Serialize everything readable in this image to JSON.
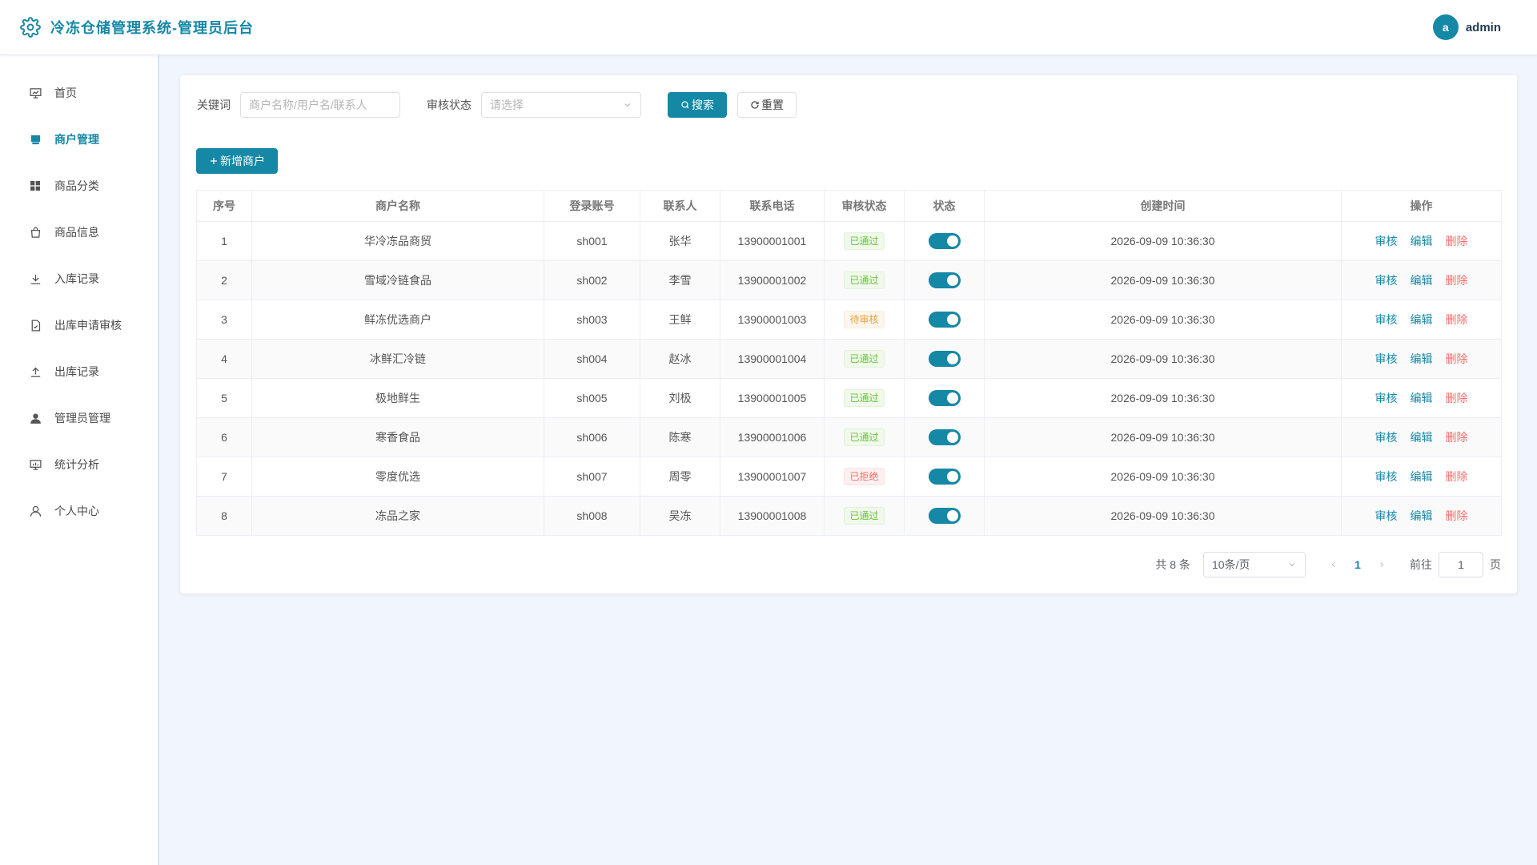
{
  "header": {
    "title": "冷冻仓储管理系统-管理员后台",
    "avatar_letter": "a",
    "username": "admin"
  },
  "sidebar": {
    "items": [
      {
        "label": "首页",
        "icon": "dashboard-icon"
      },
      {
        "label": "商户管理",
        "icon": "store-icon",
        "active": true
      },
      {
        "label": "商品分类",
        "icon": "grid-icon"
      },
      {
        "label": "商品信息",
        "icon": "bag-icon"
      },
      {
        "label": "入库记录",
        "icon": "download-icon"
      },
      {
        "label": "出库申请审核",
        "icon": "doc-check-icon"
      },
      {
        "label": "出库记录",
        "icon": "upload-icon"
      },
      {
        "label": "管理员管理",
        "icon": "user-solid-icon"
      },
      {
        "label": "统计分析",
        "icon": "chart-icon"
      },
      {
        "label": "个人中心",
        "icon": "user-icon"
      }
    ]
  },
  "filters": {
    "keyword_label": "关键词",
    "keyword_placeholder": "商户名称/用户名/联系人",
    "status_label": "审核状态",
    "status_placeholder": "请选择",
    "search_label": "搜索",
    "reset_label": "重置"
  },
  "toolbar": {
    "add_label": "新增商户"
  },
  "table": {
    "columns": [
      "序号",
      "商户名称",
      "登录账号",
      "联系人",
      "联系电话",
      "审核状态",
      "状态",
      "创建时间",
      "操作"
    ],
    "actions": {
      "audit": "审核",
      "edit": "编辑",
      "delete": "删除"
    },
    "rows": [
      {
        "no": "1",
        "name": "华冷冻品商贸",
        "account": "sh001",
        "contact": "张华",
        "phone": "13900001001",
        "audit": "已通过",
        "audit_kind": "ok",
        "enabled": true,
        "created": "2026-09-09 10:36:30"
      },
      {
        "no": "2",
        "name": "雪域冷链食品",
        "account": "sh002",
        "contact": "李雪",
        "phone": "13900001002",
        "audit": "已通过",
        "audit_kind": "ok",
        "enabled": true,
        "created": "2026-09-09 10:36:30"
      },
      {
        "no": "3",
        "name": "鲜冻优选商户",
        "account": "sh003",
        "contact": "王鲜",
        "phone": "13900001003",
        "audit": "待审核",
        "audit_kind": "pending",
        "enabled": true,
        "created": "2026-09-09 10:36:30"
      },
      {
        "no": "4",
        "name": "冰鲜汇冷链",
        "account": "sh004",
        "contact": "赵冰",
        "phone": "13900001004",
        "audit": "已通过",
        "audit_kind": "ok",
        "enabled": true,
        "created": "2026-09-09 10:36:30"
      },
      {
        "no": "5",
        "name": "极地鲜生",
        "account": "sh005",
        "contact": "刘极",
        "phone": "13900001005",
        "audit": "已通过",
        "audit_kind": "ok",
        "enabled": true,
        "created": "2026-09-09 10:36:30"
      },
      {
        "no": "6",
        "name": "寒香食品",
        "account": "sh006",
        "contact": "陈寒",
        "phone": "13900001006",
        "audit": "已通过",
        "audit_kind": "ok",
        "enabled": true,
        "created": "2026-09-09 10:36:30"
      },
      {
        "no": "7",
        "name": "零度优选",
        "account": "sh007",
        "contact": "周零",
        "phone": "13900001007",
        "audit": "已拒绝",
        "audit_kind": "rejected",
        "enabled": true,
        "created": "2026-09-09 10:36:30"
      },
      {
        "no": "8",
        "name": "冻品之家",
        "account": "sh008",
        "contact": "吴冻",
        "phone": "13900001008",
        "audit": "已通过",
        "audit_kind": "ok",
        "enabled": true,
        "created": "2026-09-09 10:36:30"
      }
    ]
  },
  "pagination": {
    "total_text": "共 8 条",
    "page_size": "10条/页",
    "current_page": "1",
    "goto_label": "前往",
    "goto_value": "1",
    "page_suffix": "页"
  },
  "colors": {
    "accent": "#1588a6",
    "success": "#67c23a",
    "warning": "#e6a23c",
    "danger": "#f56c6c",
    "background": "#f0f6fb"
  }
}
